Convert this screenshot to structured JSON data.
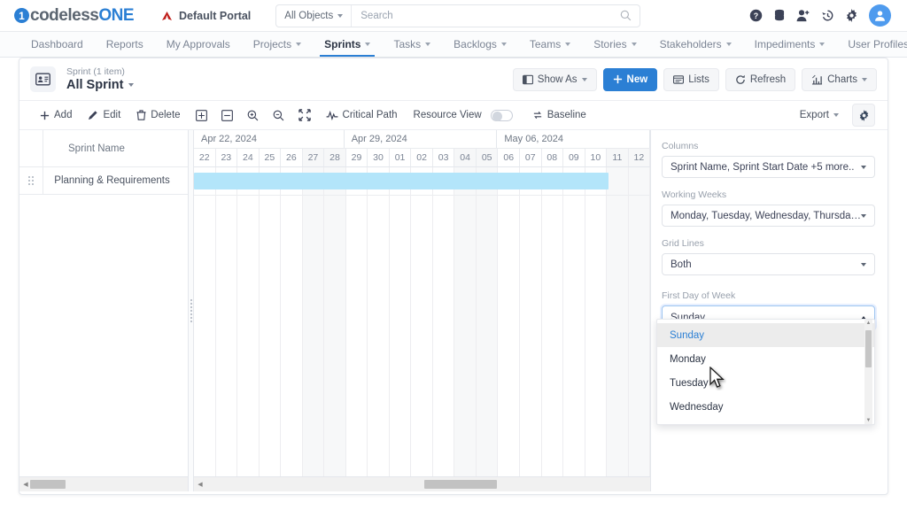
{
  "brand": {
    "logo_icon": "circle-one-icon",
    "name_part1": "codeless",
    "name_part2": "ONE"
  },
  "portal": {
    "icon": "portal-triangle-icon",
    "label": "Default Portal"
  },
  "search": {
    "scope_label": "All Objects",
    "placeholder": "Search",
    "value": "",
    "icon": "search-icon"
  },
  "header_icons": [
    {
      "name": "help-icon",
      "glyph": "?"
    },
    {
      "name": "database-icon",
      "glyph": ""
    },
    {
      "name": "add-user-icon",
      "glyph": ""
    },
    {
      "name": "history-icon",
      "glyph": ""
    },
    {
      "name": "gear-icon",
      "glyph": ""
    },
    {
      "name": "avatar",
      "glyph": ""
    }
  ],
  "nav": [
    {
      "label": "Dashboard",
      "dropdown": false,
      "active": false
    },
    {
      "label": "Reports",
      "dropdown": false,
      "active": false
    },
    {
      "label": "My Approvals",
      "dropdown": false,
      "active": false
    },
    {
      "label": "Projects",
      "dropdown": true,
      "active": false
    },
    {
      "label": "Sprints",
      "dropdown": true,
      "active": true
    },
    {
      "label": "Tasks",
      "dropdown": true,
      "active": false
    },
    {
      "label": "Backlogs",
      "dropdown": true,
      "active": false
    },
    {
      "label": "Teams",
      "dropdown": true,
      "active": false
    },
    {
      "label": "Stories",
      "dropdown": true,
      "active": false
    },
    {
      "label": "Stakeholders",
      "dropdown": true,
      "active": false
    },
    {
      "label": "Impediments",
      "dropdown": true,
      "active": false
    },
    {
      "label": "User Profiles",
      "dropdown": true,
      "active": false
    }
  ],
  "page": {
    "icon": "record-card-icon",
    "subtitle": "Sprint (1 item)",
    "title": "All Sprint"
  },
  "header_buttons": [
    {
      "label": "Show As",
      "icon": "layout-icon",
      "caret": true,
      "primary": false
    },
    {
      "label": "New",
      "icon": "plus-icon",
      "caret": false,
      "primary": true
    },
    {
      "label": "Lists",
      "icon": "list-icon",
      "caret": false,
      "primary": false
    },
    {
      "label": "Refresh",
      "icon": "refresh-icon",
      "caret": false,
      "primary": false
    },
    {
      "label": "Charts",
      "icon": "chart-icon",
      "caret": true,
      "primary": false
    }
  ],
  "toolbar": {
    "items": [
      {
        "label": "Add",
        "icon": "plus-icon"
      },
      {
        "label": "Edit",
        "icon": "pencil-icon"
      },
      {
        "label": "Delete",
        "icon": "trash-icon"
      },
      {
        "label": "",
        "icon": "expand-all-icon"
      },
      {
        "label": "",
        "icon": "collapse-all-icon"
      },
      {
        "label": "",
        "icon": "zoom-in-icon"
      },
      {
        "label": "",
        "icon": "zoom-out-icon"
      },
      {
        "label": "",
        "icon": "fit-to-screen-icon"
      },
      {
        "label": "Critical Path",
        "icon": "critical-path-icon"
      }
    ],
    "resource_view_label": "Resource View",
    "resource_view_on": false,
    "baseline_label": "Baseline",
    "baseline_icon": "baseline-icon",
    "export_label": "Export",
    "settings_icon": "gear-icon"
  },
  "grid": {
    "drag_handle_icon": "drag-handle-icon",
    "column_header": "Sprint Name",
    "rows": [
      {
        "name": "Planning & Requirements"
      }
    ]
  },
  "chart_data": {
    "type": "gantt",
    "title": "All Sprint",
    "weeks": [
      {
        "label": "Apr 22, 2024",
        "days": 7
      },
      {
        "label": "Apr 29, 2024",
        "days": 7
      },
      {
        "label": "May 06, 2024",
        "days": 7
      }
    ],
    "days": [
      "22",
      "23",
      "24",
      "25",
      "26",
      "27",
      "28",
      "29",
      "30",
      "01",
      "02",
      "03",
      "04",
      "05",
      "06",
      "07",
      "08",
      "09",
      "10",
      "11",
      "12"
    ],
    "weekend_indices": [
      5,
      6,
      12,
      13,
      19,
      20
    ],
    "grid_lines": "Both",
    "tasks": [
      {
        "name": "Planning & Requirements",
        "start_index": 0,
        "span_days": 18.5,
        "color": "#b3e5fa"
      }
    ]
  },
  "settings": {
    "fields": [
      {
        "label": "Columns",
        "value": "Sprint Name, Sprint Start Date   +5 more.."
      },
      {
        "label": "Working Weeks",
        "value": "Monday, Tuesday, Wednesday, Thursday, Friday"
      },
      {
        "label": "Grid Lines",
        "value": "Both"
      },
      {
        "label": "First Day of Week",
        "value": "Sunday"
      }
    ],
    "open_dropdown": {
      "field_label": "First Day of Week",
      "selected": "Sunday",
      "options": [
        "Sunday",
        "Monday",
        "Tuesday",
        "Wednesday"
      ]
    }
  },
  "colors": {
    "accent": "#2b7fd4",
    "bar": "#b3e5fa",
    "selected_option": "#2b7fd4"
  }
}
